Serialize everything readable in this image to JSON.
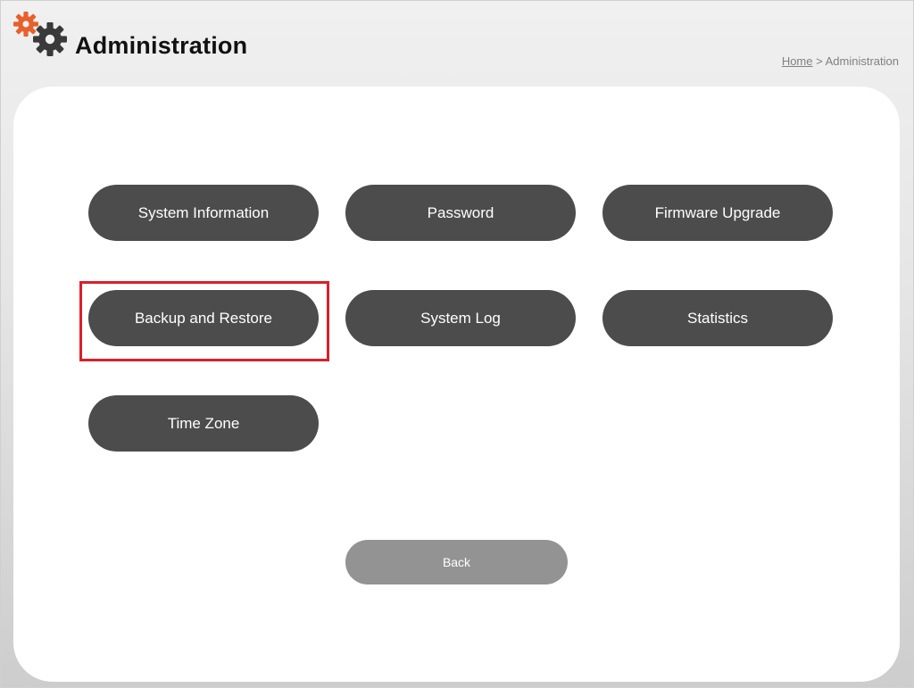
{
  "header": {
    "title": "Administration",
    "logo_icon": "gears-icon",
    "accent_color": "#e8602c"
  },
  "breadcrumb": {
    "home": "Home",
    "separator": ">",
    "current": "Administration"
  },
  "menu": {
    "items": [
      {
        "label": "System Information",
        "highlighted": false
      },
      {
        "label": "Password",
        "highlighted": false
      },
      {
        "label": "Firmware Upgrade",
        "highlighted": false
      },
      {
        "label": "Backup and Restore",
        "highlighted": true
      },
      {
        "label": "System Log",
        "highlighted": false
      },
      {
        "label": "Statistics",
        "highlighted": false
      },
      {
        "label": "Time Zone",
        "highlighted": false
      }
    ],
    "button_color": "#4c4c4c",
    "highlight_color": "#d9202a"
  },
  "back": {
    "label": "Back",
    "color": "#939393"
  }
}
